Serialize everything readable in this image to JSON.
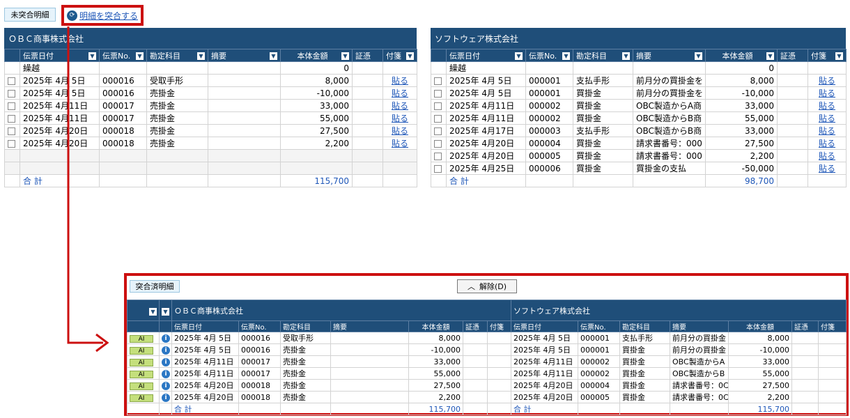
{
  "tabs": {
    "unmatched_label": "未突合明細",
    "match_action_label": "明細を突合する"
  },
  "left_panel": {
    "company": "ＯＢＣ商事株式会社",
    "headers": [
      "伝票日付",
      "伝票No.",
      "勘定科目",
      "摘要",
      "本体金額",
      "証憑",
      "付箋"
    ],
    "carryover_label": "繰越",
    "carryover_amount": "0",
    "rows": [
      {
        "date": "2025年  4月  5日",
        "no": "000016",
        "account": "受取手形",
        "summary": "",
        "amount": "8,000",
        "attach": "貼る"
      },
      {
        "date": "2025年  4月  5日",
        "no": "000016",
        "account": "売掛金",
        "summary": "",
        "amount": "-10,000",
        "attach": "貼る"
      },
      {
        "date": "2025年  4月11日",
        "no": "000017",
        "account": "売掛金",
        "summary": "",
        "amount": "33,000",
        "attach": "貼る"
      },
      {
        "date": "2025年  4月11日",
        "no": "000017",
        "account": "売掛金",
        "summary": "",
        "amount": "55,000",
        "attach": "貼る"
      },
      {
        "date": "2025年  4月20日",
        "no": "000018",
        "account": "売掛金",
        "summary": "",
        "amount": "27,500",
        "attach": "貼る"
      },
      {
        "date": "2025年  4月20日",
        "no": "000018",
        "account": "売掛金",
        "summary": "",
        "amount": "2,200",
        "attach": "貼る"
      }
    ],
    "total_label": "合   計",
    "total_amount": "115,700"
  },
  "right_panel": {
    "company": "ソフトウェア株式会社",
    "headers": [
      "伝票日付",
      "伝票No.",
      "勘定科目",
      "摘要",
      "本体金額",
      "証憑",
      "付箋"
    ],
    "carryover_label": "繰越",
    "carryover_amount": "0",
    "rows": [
      {
        "date": "2025年  4月  5日",
        "no": "000001",
        "account": "支払手形",
        "summary": "前月分の買掛金を",
        "amount": "8,000",
        "attach": "貼る"
      },
      {
        "date": "2025年  4月  5日",
        "no": "000001",
        "account": "買掛金",
        "summary": "前月分の買掛金を",
        "amount": "-10,000",
        "attach": "貼る"
      },
      {
        "date": "2025年  4月11日",
        "no": "000002",
        "account": "買掛金",
        "summary": "OBC製造からA商",
        "amount": "33,000",
        "attach": "貼る"
      },
      {
        "date": "2025年  4月11日",
        "no": "000002",
        "account": "買掛金",
        "summary": "OBC製造からB商",
        "amount": "55,000",
        "attach": "貼る"
      },
      {
        "date": "2025年  4月17日",
        "no": "000003",
        "account": "支払手形",
        "summary": "OBC製造からB商",
        "amount": "33,000",
        "attach": "貼る"
      },
      {
        "date": "2025年  4月20日",
        "no": "000004",
        "account": "買掛金",
        "summary": "請求書番号：000",
        "amount": "27,500",
        "attach": "貼る"
      },
      {
        "date": "2025年  4月20日",
        "no": "000005",
        "account": "買掛金",
        "summary": "請求書番号：000",
        "amount": "2,200",
        "attach": "貼る"
      },
      {
        "date": "2025年  4月25日",
        "no": "000006",
        "account": "買掛金",
        "summary": "買掛金の支払",
        "amount": "-50,000",
        "attach": "貼る"
      }
    ],
    "total_label": "合   計",
    "total_amount": "98,700"
  },
  "matched_panel": {
    "tab_label": "突合済明細",
    "unmatch_button": "解除(D)",
    "left_company": "ＯＢＣ商事株式会社",
    "right_company": "ソフトウェア株式会社",
    "headers": [
      "伝票日付",
      "伝票No.",
      "勘定科目",
      "摘要",
      "本体金額",
      "証憑",
      "付箋"
    ],
    "badge": "AI",
    "rows": [
      {
        "l_date": "2025年  4月  5日",
        "l_no": "000016",
        "l_account": "受取手形",
        "l_summary": "",
        "l_amount": "8,000",
        "r_date": "2025年  4月  5日",
        "r_no": "000001",
        "r_account": "支払手形",
        "r_summary": "前月分の買掛金",
        "r_amount": "8,000"
      },
      {
        "l_date": "2025年  4月  5日",
        "l_no": "000016",
        "l_account": "売掛金",
        "l_summary": "",
        "l_amount": "-10,000",
        "r_date": "2025年  4月  5日",
        "r_no": "000001",
        "r_account": "買掛金",
        "r_summary": "前月分の買掛金",
        "r_amount": "-10,000"
      },
      {
        "l_date": "2025年  4月11日",
        "l_no": "000017",
        "l_account": "売掛金",
        "l_summary": "",
        "l_amount": "33,000",
        "r_date": "2025年  4月11日",
        "r_no": "000002",
        "r_account": "買掛金",
        "r_summary": "OBC製造からA",
        "r_amount": "33,000"
      },
      {
        "l_date": "2025年  4月11日",
        "l_no": "000017",
        "l_account": "売掛金",
        "l_summary": "",
        "l_amount": "55,000",
        "r_date": "2025年  4月11日",
        "r_no": "000002",
        "r_account": "買掛金",
        "r_summary": "OBC製造からB",
        "r_amount": "55,000"
      },
      {
        "l_date": "2025年  4月20日",
        "l_no": "000018",
        "l_account": "売掛金",
        "l_summary": "",
        "l_amount": "27,500",
        "r_date": "2025年  4月20日",
        "r_no": "000004",
        "r_account": "買掛金",
        "r_summary": "請求書番号：0C",
        "r_amount": "27,500"
      },
      {
        "l_date": "2025年  4月20日",
        "l_no": "000018",
        "l_account": "売掛金",
        "l_summary": "",
        "l_amount": "2,200",
        "r_date": "2025年  4月20日",
        "r_no": "000005",
        "r_account": "買掛金",
        "r_summary": "請求書番号：0C",
        "r_amount": "2,200"
      }
    ],
    "left_total_label": "合   計",
    "left_total": "115,700",
    "right_total_label": "合   計",
    "right_total": "115,700"
  },
  "colors": {
    "header_bg": "#1f4e79",
    "highlight": "#cc1010",
    "link": "#1f57b8"
  }
}
